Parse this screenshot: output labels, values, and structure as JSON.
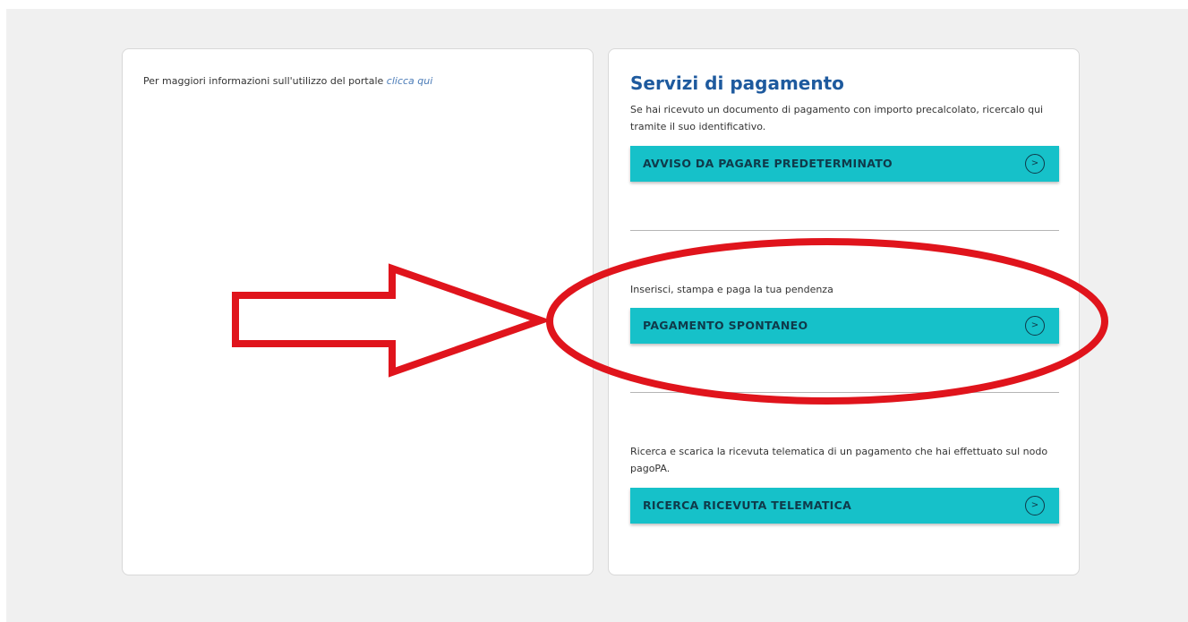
{
  "info_panel": {
    "text": "Per maggiori informazioni sull'utilizzo del portale ",
    "link_label": "clicca qui"
  },
  "payment_panel": {
    "title": "Servizi di pagamento",
    "sections": [
      {
        "description": "Se hai ricevuto un documento di pagamento con importo precalcolato, ricercalo qui tramite il suo identificativo.",
        "button_label": "AVVISO DA PAGARE PREDETERMINATO"
      },
      {
        "description": "Inserisci, stampa e paga la tua pendenza",
        "button_label": "PAGAMENTO SPONTANEO"
      },
      {
        "description": "Ricerca e scarica la ricevuta telematica di un pagamento che hai effettuato sul nodo pagoPA.",
        "button_label": "RICERCA RICEVUTA TELEMATICA"
      }
    ],
    "chevron_icon": "chevron-right-circle-icon"
  },
  "annotation": {
    "shapes": [
      "arrow-right",
      "ellipse"
    ],
    "color": "#e0141c"
  },
  "colors": {
    "title": "#1e5a9e",
    "button_bg": "#16c1c9",
    "button_text": "#0f3a4a",
    "link": "#4a7bb7"
  }
}
